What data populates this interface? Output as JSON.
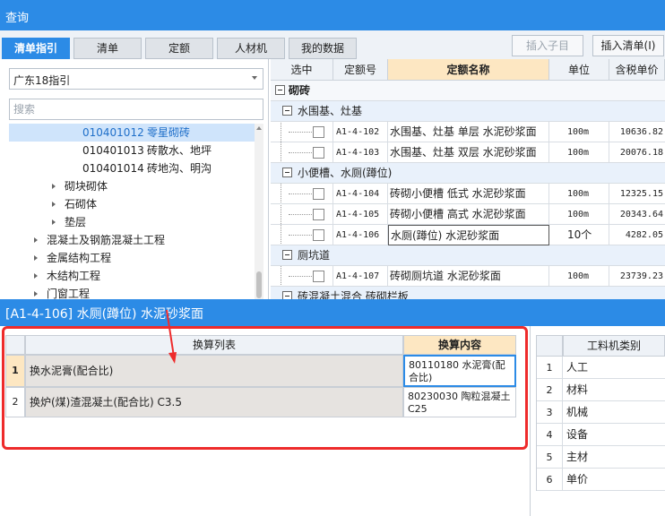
{
  "window": {
    "title": "查询"
  },
  "tabs": [
    {
      "label": "清单指引",
      "active": true
    },
    {
      "label": "清单",
      "active": false
    },
    {
      "label": "定额",
      "active": false
    },
    {
      "label": "人材机",
      "active": false
    },
    {
      "label": "我的数据",
      "active": false
    }
  ],
  "toolbar": {
    "insert_child_label": "插入子目",
    "insert_list_label": "插入清单(I)"
  },
  "left": {
    "guide_select": {
      "value": "广东18指引"
    },
    "search": {
      "placeholder": "搜索",
      "value": ""
    },
    "tree": [
      {
        "code": "010401012",
        "name": "零星砌砖",
        "selected": true,
        "expandable": false
      },
      {
        "code": "010401013",
        "name": "砖散水、地坪",
        "selected": false,
        "expandable": false
      },
      {
        "code": "010401014",
        "name": "砖地沟、明沟",
        "selected": false,
        "expandable": false
      },
      {
        "code": "",
        "name": "砌块砌体",
        "selected": false,
        "expandable": true
      },
      {
        "code": "",
        "name": "石砌体",
        "selected": false,
        "expandable": true
      },
      {
        "code": "",
        "name": "垫层",
        "selected": false,
        "expandable": true
      },
      {
        "code": "",
        "name": "混凝土及钢筋混凝土工程",
        "selected": false,
        "expandable": true
      },
      {
        "code": "",
        "name": "金属结构工程",
        "selected": false,
        "expandable": true
      },
      {
        "code": "",
        "name": "木结构工程",
        "selected": false,
        "expandable": true
      },
      {
        "code": "",
        "name": "门窗工程",
        "selected": false,
        "expandable": true
      }
    ]
  },
  "grid": {
    "headers": [
      "选中",
      "定额号",
      "定额名称",
      "单位",
      "含税单价"
    ],
    "rows": [
      {
        "type": "group",
        "label": "砌砖"
      },
      {
        "type": "subgroup",
        "label": "水围基、灶基"
      },
      {
        "type": "item",
        "code": "A1-4-102",
        "name": "水围基、灶基 单层 水泥砂浆面",
        "unit": "100m",
        "price": "10636.82"
      },
      {
        "type": "item",
        "code": "A1-4-103",
        "name": "水围基、灶基 双层 水泥砂浆面",
        "unit": "100m",
        "price": "20076.18"
      },
      {
        "type": "subgroup",
        "label": "小便槽、水厕(蹲位)"
      },
      {
        "type": "item",
        "code": "A1-4-104",
        "name": "砖砌小便槽 低式 水泥砂浆面",
        "unit": "100m",
        "price": "12325.15"
      },
      {
        "type": "item",
        "code": "A1-4-105",
        "name": "砖砌小便槽 高式 水泥砂浆面",
        "unit": "100m",
        "price": "20343.64"
      },
      {
        "type": "item",
        "code": "A1-4-106",
        "name": "水厕(蹲位) 水泥砂浆面",
        "unit": "10个",
        "price": "4282.05",
        "focused": true
      },
      {
        "type": "subgroup",
        "label": "厕坑道"
      },
      {
        "type": "item",
        "code": "A1-4-107",
        "name": "砖砌厕坑道 水泥砂浆面",
        "unit": "100m",
        "price": "23739.23"
      },
      {
        "type": "subgroup",
        "label": "砖混凝土混合 砖砌栏板"
      }
    ]
  },
  "detail": {
    "title": "[A1-4-106] 水厕(蹲位) 水泥砂浆面",
    "headers": [
      "换算列表",
      "换算内容"
    ],
    "rows": [
      {
        "num": "1",
        "desc": "换水泥膏(配合比)",
        "content": "80110180   水泥膏(配合比)"
      },
      {
        "num": "2",
        "desc": "换炉(煤)渣混凝土(配合比) C3.5",
        "content": "80230030   陶粒混凝土 C25"
      }
    ]
  },
  "labor_types": {
    "header": "工料机类别",
    "items": [
      {
        "num": "1",
        "label": "人工"
      },
      {
        "num": "2",
        "label": "材料"
      },
      {
        "num": "3",
        "label": "机械"
      },
      {
        "num": "4",
        "label": "设备"
      },
      {
        "num": "5",
        "label": "主材"
      },
      {
        "num": "6",
        "label": "单价"
      }
    ]
  },
  "colors": {
    "accent": "#2c8be6",
    "highlight": "#ee2b2b",
    "header_hi": "#fde7c2"
  }
}
